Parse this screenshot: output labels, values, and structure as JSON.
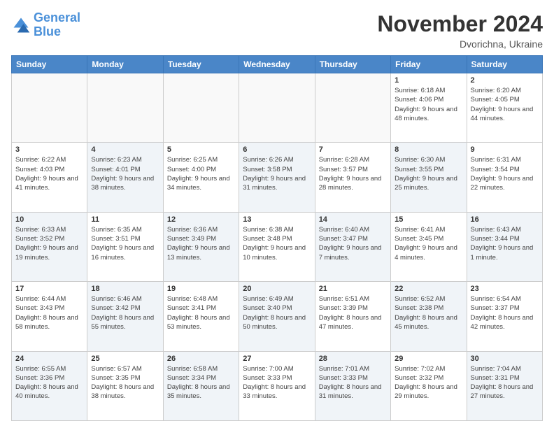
{
  "logo": {
    "line1": "General",
    "line2": "Blue"
  },
  "title": "November 2024",
  "subtitle": "Dvorichna, Ukraine",
  "days_header": [
    "Sunday",
    "Monday",
    "Tuesday",
    "Wednesday",
    "Thursday",
    "Friday",
    "Saturday"
  ],
  "weeks": [
    [
      {
        "day": "",
        "info": ""
      },
      {
        "day": "",
        "info": ""
      },
      {
        "day": "",
        "info": ""
      },
      {
        "day": "",
        "info": ""
      },
      {
        "day": "",
        "info": ""
      },
      {
        "day": "1",
        "info": "Sunrise: 6:18 AM\nSunset: 4:06 PM\nDaylight: 9 hours and 48 minutes."
      },
      {
        "day": "2",
        "info": "Sunrise: 6:20 AM\nSunset: 4:05 PM\nDaylight: 9 hours and 44 minutes."
      }
    ],
    [
      {
        "day": "3",
        "info": "Sunrise: 6:22 AM\nSunset: 4:03 PM\nDaylight: 9 hours and 41 minutes."
      },
      {
        "day": "4",
        "info": "Sunrise: 6:23 AM\nSunset: 4:01 PM\nDaylight: 9 hours and 38 minutes."
      },
      {
        "day": "5",
        "info": "Sunrise: 6:25 AM\nSunset: 4:00 PM\nDaylight: 9 hours and 34 minutes."
      },
      {
        "day": "6",
        "info": "Sunrise: 6:26 AM\nSunset: 3:58 PM\nDaylight: 9 hours and 31 minutes."
      },
      {
        "day": "7",
        "info": "Sunrise: 6:28 AM\nSunset: 3:57 PM\nDaylight: 9 hours and 28 minutes."
      },
      {
        "day": "8",
        "info": "Sunrise: 6:30 AM\nSunset: 3:55 PM\nDaylight: 9 hours and 25 minutes."
      },
      {
        "day": "9",
        "info": "Sunrise: 6:31 AM\nSunset: 3:54 PM\nDaylight: 9 hours and 22 minutes."
      }
    ],
    [
      {
        "day": "10",
        "info": "Sunrise: 6:33 AM\nSunset: 3:52 PM\nDaylight: 9 hours and 19 minutes."
      },
      {
        "day": "11",
        "info": "Sunrise: 6:35 AM\nSunset: 3:51 PM\nDaylight: 9 hours and 16 minutes."
      },
      {
        "day": "12",
        "info": "Sunrise: 6:36 AM\nSunset: 3:49 PM\nDaylight: 9 hours and 13 minutes."
      },
      {
        "day": "13",
        "info": "Sunrise: 6:38 AM\nSunset: 3:48 PM\nDaylight: 9 hours and 10 minutes."
      },
      {
        "day": "14",
        "info": "Sunrise: 6:40 AM\nSunset: 3:47 PM\nDaylight: 9 hours and 7 minutes."
      },
      {
        "day": "15",
        "info": "Sunrise: 6:41 AM\nSunset: 3:45 PM\nDaylight: 9 hours and 4 minutes."
      },
      {
        "day": "16",
        "info": "Sunrise: 6:43 AM\nSunset: 3:44 PM\nDaylight: 9 hours and 1 minute."
      }
    ],
    [
      {
        "day": "17",
        "info": "Sunrise: 6:44 AM\nSunset: 3:43 PM\nDaylight: 8 hours and 58 minutes."
      },
      {
        "day": "18",
        "info": "Sunrise: 6:46 AM\nSunset: 3:42 PM\nDaylight: 8 hours and 55 minutes."
      },
      {
        "day": "19",
        "info": "Sunrise: 6:48 AM\nSunset: 3:41 PM\nDaylight: 8 hours and 53 minutes."
      },
      {
        "day": "20",
        "info": "Sunrise: 6:49 AM\nSunset: 3:40 PM\nDaylight: 8 hours and 50 minutes."
      },
      {
        "day": "21",
        "info": "Sunrise: 6:51 AM\nSunset: 3:39 PM\nDaylight: 8 hours and 47 minutes."
      },
      {
        "day": "22",
        "info": "Sunrise: 6:52 AM\nSunset: 3:38 PM\nDaylight: 8 hours and 45 minutes."
      },
      {
        "day": "23",
        "info": "Sunrise: 6:54 AM\nSunset: 3:37 PM\nDaylight: 8 hours and 42 minutes."
      }
    ],
    [
      {
        "day": "24",
        "info": "Sunrise: 6:55 AM\nSunset: 3:36 PM\nDaylight: 8 hours and 40 minutes."
      },
      {
        "day": "25",
        "info": "Sunrise: 6:57 AM\nSunset: 3:35 PM\nDaylight: 8 hours and 38 minutes."
      },
      {
        "day": "26",
        "info": "Sunrise: 6:58 AM\nSunset: 3:34 PM\nDaylight: 8 hours and 35 minutes."
      },
      {
        "day": "27",
        "info": "Sunrise: 7:00 AM\nSunset: 3:33 PM\nDaylight: 8 hours and 33 minutes."
      },
      {
        "day": "28",
        "info": "Sunrise: 7:01 AM\nSunset: 3:33 PM\nDaylight: 8 hours and 31 minutes."
      },
      {
        "day": "29",
        "info": "Sunrise: 7:02 AM\nSunset: 3:32 PM\nDaylight: 8 hours and 29 minutes."
      },
      {
        "day": "30",
        "info": "Sunrise: 7:04 AM\nSunset: 3:31 PM\nDaylight: 8 hours and 27 minutes."
      }
    ]
  ]
}
